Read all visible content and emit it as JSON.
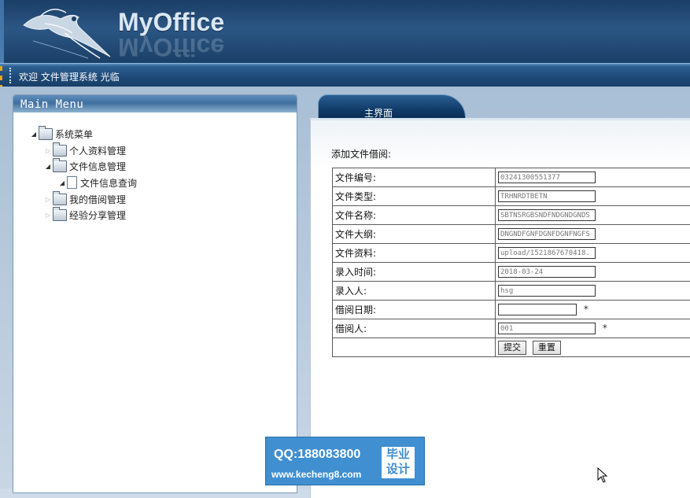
{
  "header": {
    "brand": "MyOffice",
    "welcome_text": "欢迎 文件管理系统 光临"
  },
  "menu": {
    "title": "Main Menu",
    "root": "系统菜单",
    "items": [
      {
        "label": "个人资料管理",
        "expanded": false
      },
      {
        "label": "文件信息管理",
        "expanded": true,
        "children": [
          "文件信息查询"
        ]
      },
      {
        "label": "我的借阅管理",
        "expanded": false
      },
      {
        "label": "经验分享管理",
        "expanded": false
      }
    ]
  },
  "tabs": [
    {
      "label": "主界面"
    }
  ],
  "form": {
    "heading": "添加文件借阅:",
    "rows": [
      {
        "label": "文件编号:",
        "value": "03241300551377"
      },
      {
        "label": "文件类型:",
        "value": "TRHNRDTBETN"
      },
      {
        "label": "文件名称:",
        "value": "SBTNSRGBSNDFNDGNDGNDS"
      },
      {
        "label": "文件大纲:",
        "value": "DNGNDFGNFDGNFDGNFNGFS"
      },
      {
        "label": "文件资料:",
        "value": "upload/1521867670418."
      },
      {
        "label": "录入时间:",
        "value": "2018-03-24"
      },
      {
        "label": "录入人:",
        "value": "hsg"
      },
      {
        "label": "借阅日期:",
        "value": "",
        "required_mark": "*"
      },
      {
        "label": "借阅人:",
        "value": "001",
        "required_mark": "*"
      }
    ],
    "submit_label": "提交",
    "reset_label": "重置"
  },
  "watermark": {
    "qq": "QQ:188083800",
    "site": "www.kecheng8.com",
    "badge_line1": "毕业",
    "badge_line2": "设计"
  }
}
